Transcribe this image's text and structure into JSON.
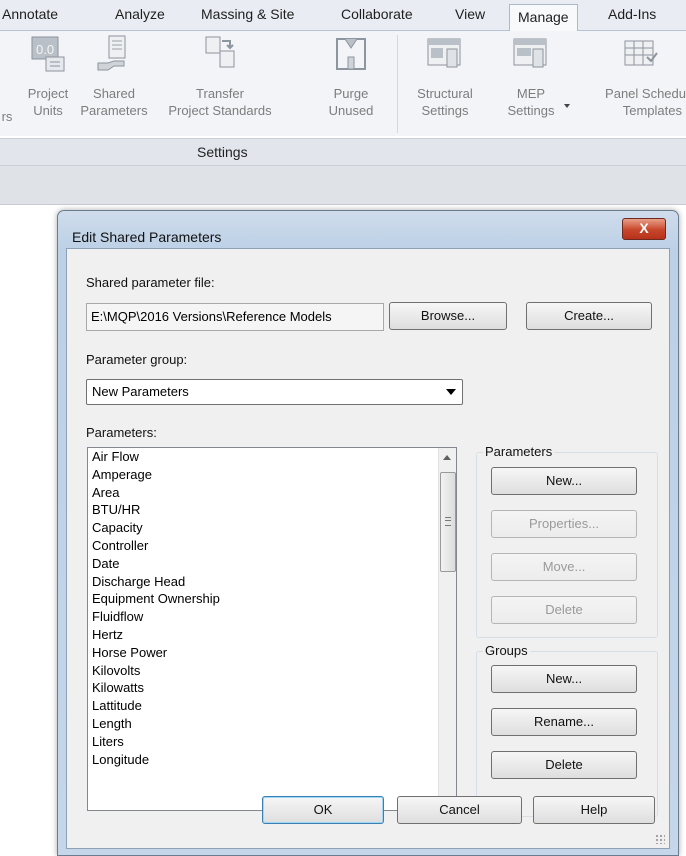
{
  "ribbon": {
    "tabs": [
      "Annotate",
      "Analyze",
      "Massing & Site",
      "Collaborate",
      "View",
      "Manage",
      "Add-Ins"
    ],
    "active_tab": "Manage",
    "buttons": {
      "rs": {
        "line2": "rs"
      },
      "project_units": {
        "line1": "Project",
        "line2": "Units"
      },
      "shared_parameters": {
        "line1": "Shared",
        "line2": "Parameters"
      },
      "transfer_standards": {
        "line1": "Transfer",
        "line2": "Project Standards"
      },
      "purge_unused": {
        "line1": "Purge",
        "line2": "Unused"
      },
      "structural_settings": {
        "line1": "Structural",
        "line2": "Settings"
      },
      "mep_settings": {
        "line1": "MEP",
        "line2": "Settings"
      },
      "panel_schedule": {
        "line1": "Panel Schedu",
        "line2": "Templates"
      }
    },
    "panel_label": "Settings"
  },
  "dialog": {
    "title": "Edit Shared Parameters",
    "close_label": "X",
    "file_label": "Shared parameter file:",
    "file_path": "E:\\MQP\\2016 Versions\\Reference Models",
    "browse_label": "Browse...",
    "create_label": "Create...",
    "group_label": "Parameter group:",
    "group_selected": "New Parameters",
    "parameters_label": "Parameters:",
    "parameters": [
      "Air Flow",
      "Amperage",
      "Area",
      "BTU/HR",
      "Capacity",
      "Controller",
      "Date",
      "Discharge Head",
      "Equipment Ownership",
      "Fluidflow",
      "Hertz",
      "Horse Power",
      "Kilovolts",
      "Kilowatts",
      "Lattitude",
      "Length",
      "Liters",
      "Longitude"
    ],
    "params_box": {
      "title": "Parameters",
      "new_label": "New...",
      "properties_label": "Properties...",
      "move_label": "Move...",
      "delete_label": "Delete"
    },
    "groups_box": {
      "title": "Groups",
      "new_label": "New...",
      "rename_label": "Rename...",
      "delete_label": "Delete"
    },
    "ok_label": "OK",
    "cancel_label": "Cancel",
    "help_label": "Help"
  }
}
